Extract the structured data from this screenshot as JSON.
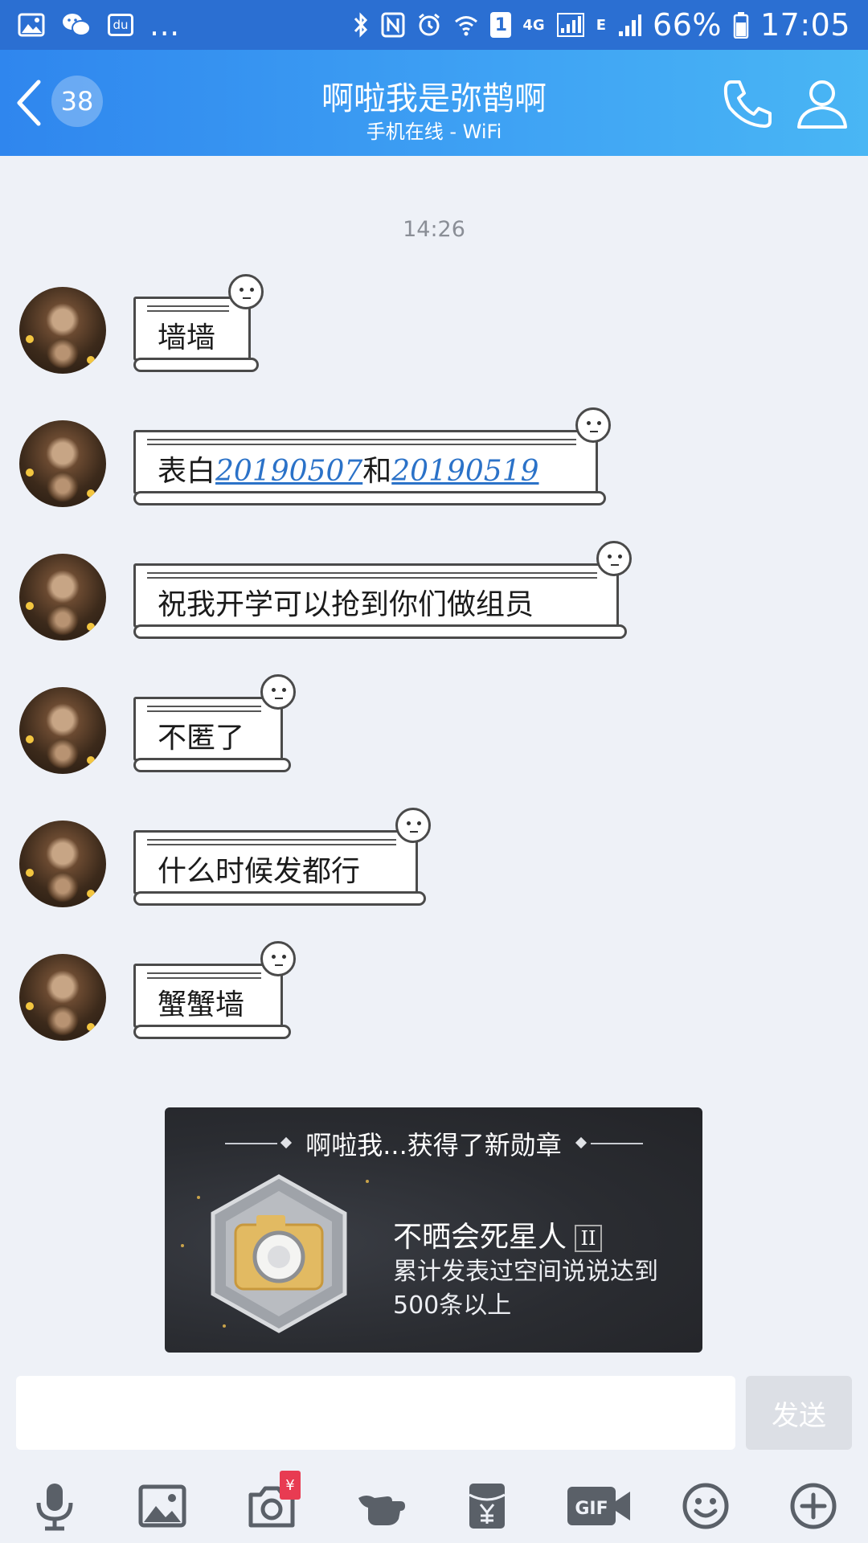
{
  "status_bar": {
    "notif_icons": [
      "gallery-icon",
      "wechat-icon",
      "baidu-icon"
    ],
    "more": "...",
    "sim_badge": "1",
    "network": "4G",
    "network2": "E",
    "battery": "66%",
    "time": "17:05"
  },
  "header": {
    "unread_count": "38",
    "title": "啊啦我是弥鹊啊",
    "subtitle": "手机在线 - WiFi"
  },
  "chat": {
    "timestamp": "14:26",
    "messages": [
      {
        "text": "墙墙"
      },
      {
        "text_a": "表白",
        "link1": "20190507",
        "text_b": "和",
        "link2": "20190519"
      },
      {
        "text": "祝我开学可以抢到你们做组员"
      },
      {
        "text": "不匿了"
      },
      {
        "text": "什么时候发都行"
      },
      {
        "text": "蟹蟹墙"
      }
    ]
  },
  "badge_card": {
    "header": "啊啦我...获得了新勋章",
    "name": "不晒会死星人",
    "level": "II",
    "description": "累计发表过空间说说达到500条以上"
  },
  "input": {
    "placeholder": "",
    "value": "",
    "send_label": "发送"
  },
  "toolbar": {
    "items": [
      "voice-icon",
      "image-icon",
      "camera-icon",
      "poke-icon",
      "red-packet-icon",
      "gif-icon",
      "emoji-icon",
      "plus-icon"
    ],
    "camera_tag": "¥"
  },
  "colors": {
    "status_bar": "#2b6fd2",
    "header_start": "#2f86ee",
    "header_end": "#49b6f4",
    "background": "#eef1f7",
    "link": "#2b72c8",
    "badge_bg": "#2a2c31"
  }
}
